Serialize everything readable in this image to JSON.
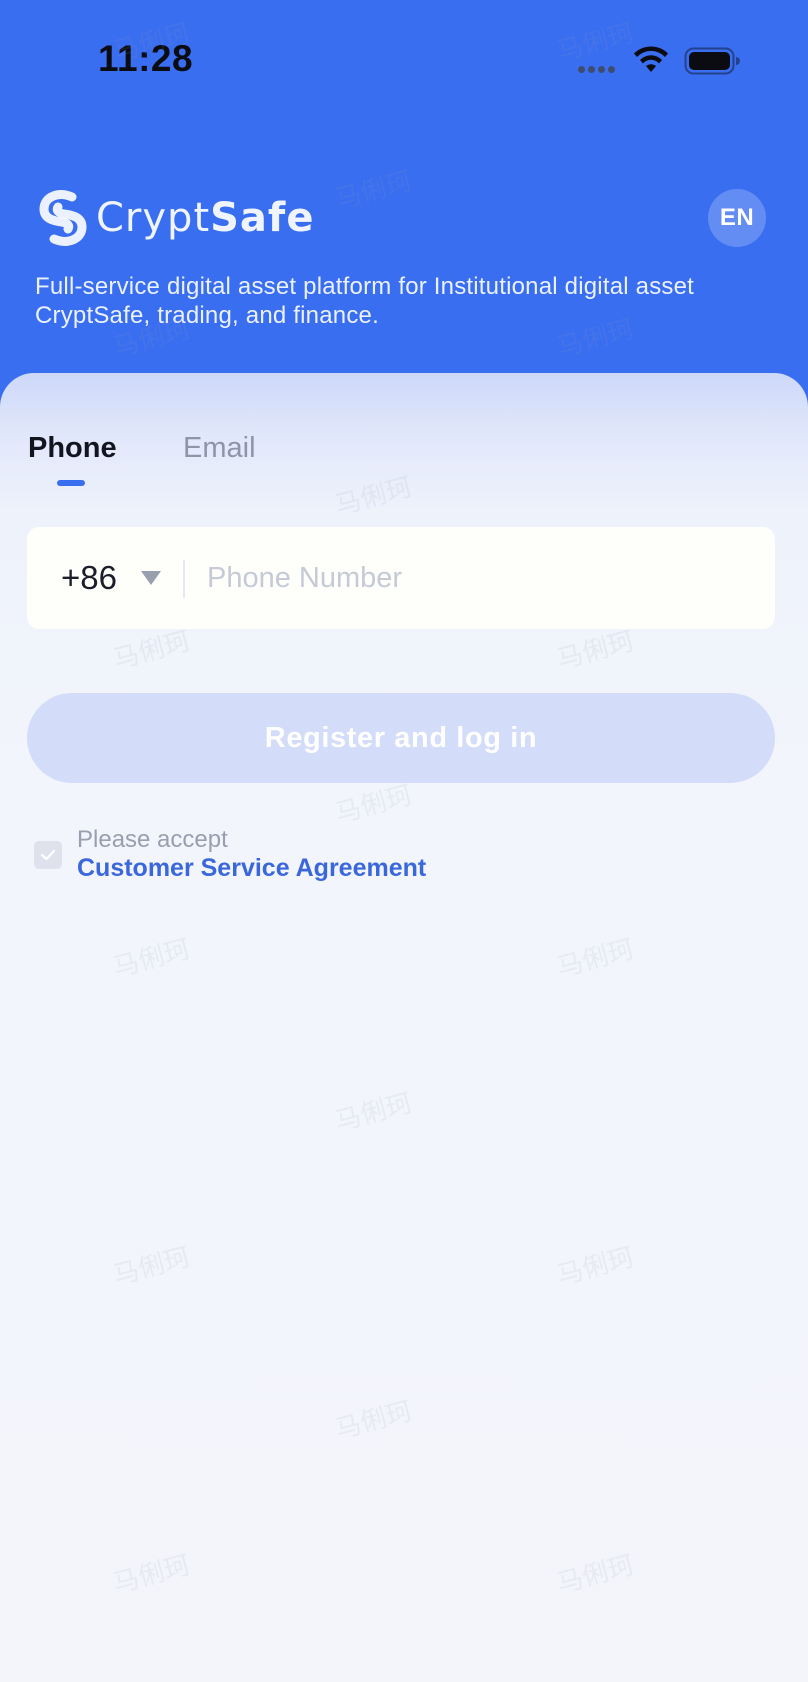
{
  "status_bar": {
    "time": "11:28"
  },
  "header": {
    "brand_part_1": "Crypt",
    "brand_part_2": "Safe",
    "language_button": "EN",
    "tagline": "Full-service digital asset platform for Institutional digital asset CryptSafe, trading, and finance."
  },
  "tabs": [
    {
      "label": "Phone",
      "active": true
    },
    {
      "label": "Email",
      "active": false
    }
  ],
  "phone_field": {
    "country_code": "+86",
    "placeholder": "Phone Number",
    "value": ""
  },
  "submit_button": {
    "label": "Register and log in"
  },
  "agreement": {
    "prompt": "Please accept",
    "link": "Customer Service Agreement",
    "checked": false
  },
  "watermark_text": "马俐珂",
  "colors": {
    "primary": "#396ef1",
    "button_disabled": "#d3dcf8",
    "link": "#3a68dc"
  },
  "icons": [
    "wifi-icon",
    "battery-icon",
    "logo-icon",
    "chevron-down-icon",
    "check-icon"
  ]
}
